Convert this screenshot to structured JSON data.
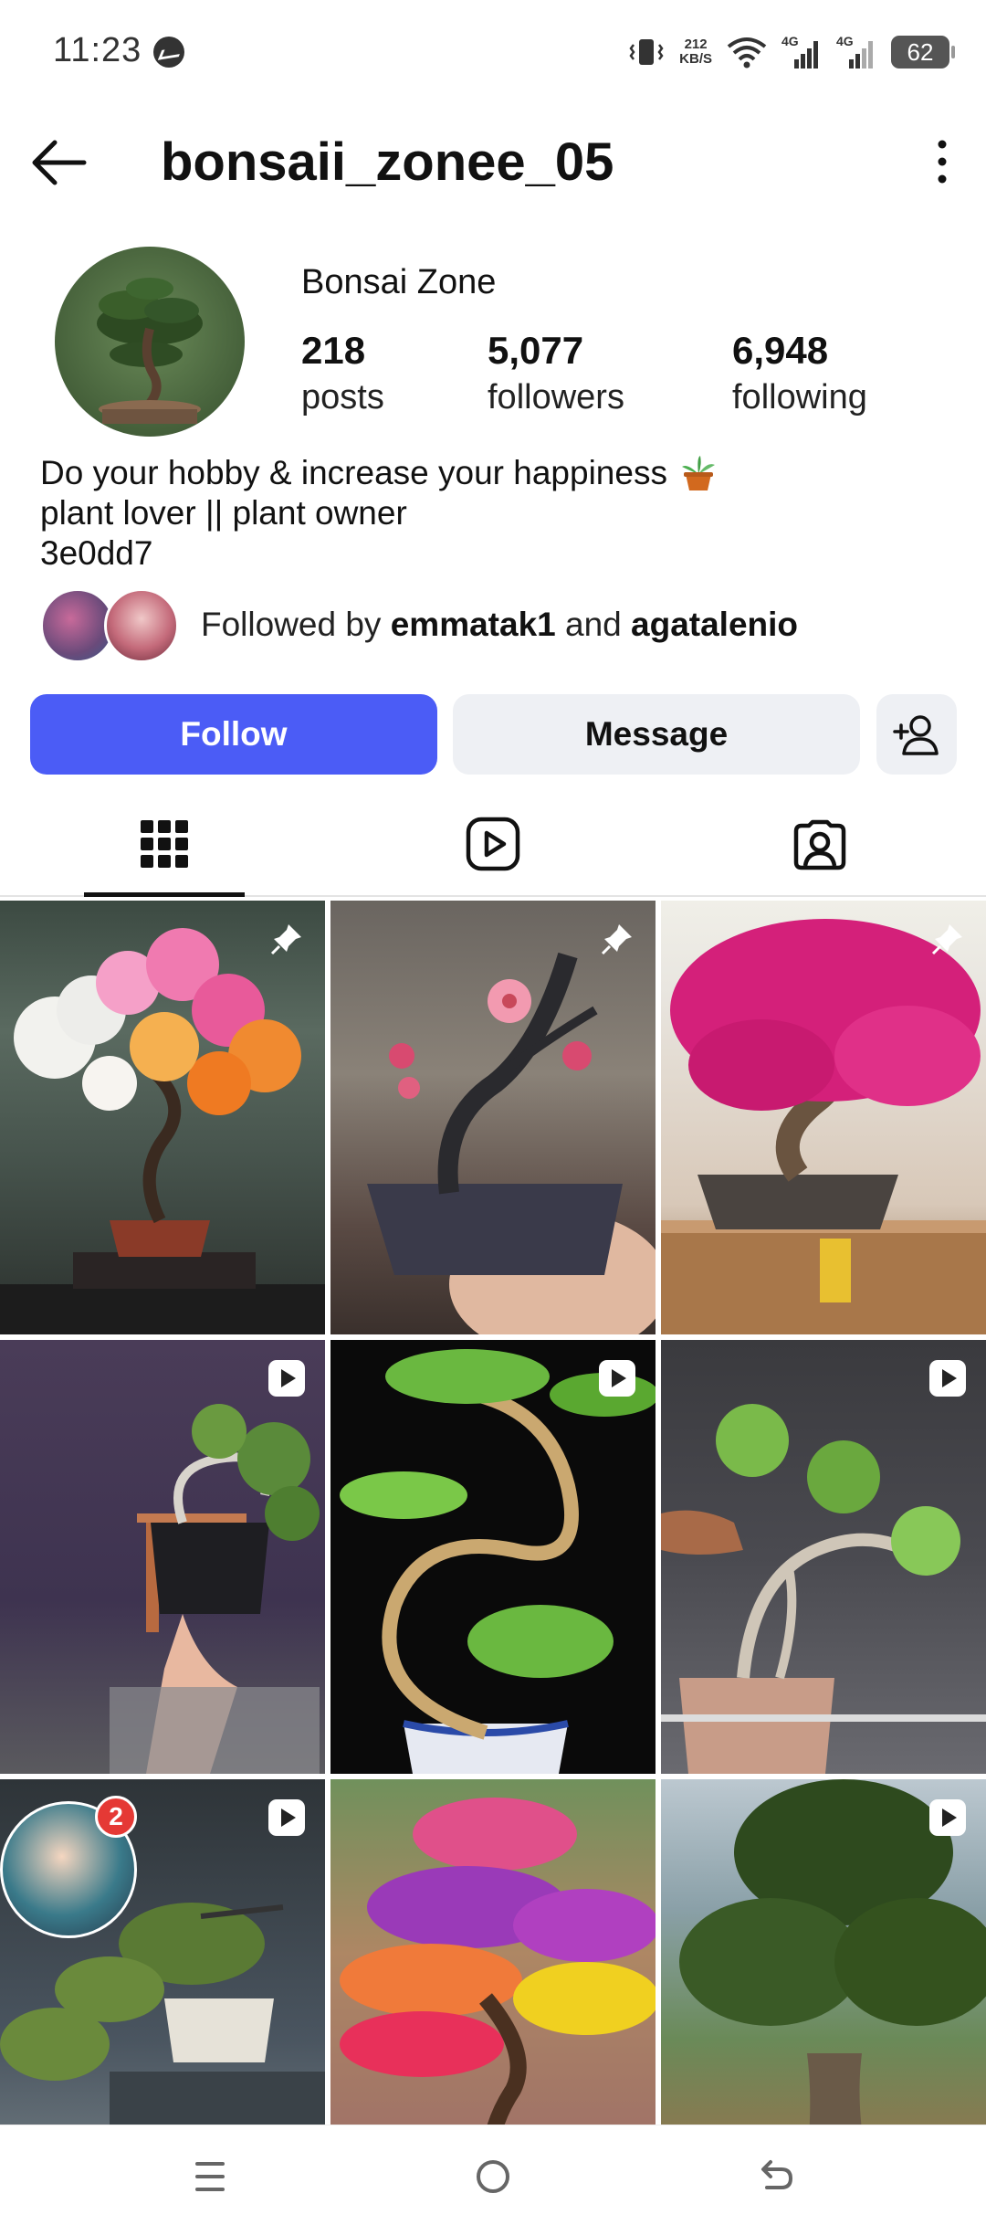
{
  "status_bar": {
    "time": "11:23",
    "net_speed_value": "212",
    "net_speed_unit": "KB/S",
    "signal1_label": "4G",
    "signal2_label": "4G",
    "battery": "62"
  },
  "header": {
    "username": "bonsaii_zonee_05"
  },
  "profile": {
    "display_name": "Bonsai Zone",
    "stats": [
      {
        "value": "218",
        "label": "posts"
      },
      {
        "value": "5,077",
        "label": "followers"
      },
      {
        "value": "6,948",
        "label": "following"
      }
    ],
    "bio": [
      "Do your hobby & increase your happiness",
      "plant lover || plant owner",
      "3e0dd7"
    ],
    "followed_by_prefix": "Followed by",
    "followed_by_user1": "emmatak1",
    "followed_by_and": "and",
    "followed_by_user2": "agatalenio"
  },
  "actions": {
    "follow_label": "Follow",
    "message_label": "Message"
  },
  "tabs": [
    "grid",
    "reels",
    "tagged"
  ],
  "grid": {
    "tiles": [
      {
        "kind": "pinned",
        "subject": "bonsai with white pink orange blossoms"
      },
      {
        "kind": "pinned",
        "subject": "miniature bonsai with pink blossoms"
      },
      {
        "kind": "pinned",
        "subject": "magenta bougainvillea bonsai"
      },
      {
        "kind": "reel",
        "subject": "hand trimming bonsai"
      },
      {
        "kind": "reel",
        "subject": "spiral trunk jade bonsai"
      },
      {
        "kind": "reel",
        "subject": "hand holding bonsai roots"
      },
      {
        "kind": "reel",
        "subject": "pruning bonsai",
        "notification_count": "2"
      },
      {
        "kind": "post",
        "subject": "rainbow blossom bonsai"
      },
      {
        "kind": "reel",
        "subject": "large outdoor banyan tree"
      }
    ]
  },
  "colors": {
    "follow_button": "#4b5cf6",
    "secondary_button": "#eef0f4",
    "notification": "#e53935"
  }
}
